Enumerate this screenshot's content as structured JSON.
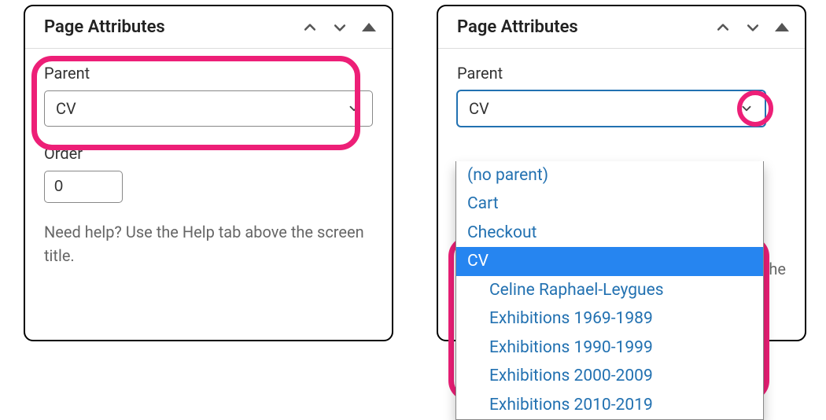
{
  "panel": {
    "title": "Page Attributes"
  },
  "parent": {
    "label": "Parent",
    "value": "CV"
  },
  "order": {
    "label": "Order",
    "value": "0"
  },
  "help": {
    "text": "Need help? Use the Help tab above the screen title."
  },
  "help_peek": "e the",
  "dropdown": {
    "no_parent": "(no parent)",
    "items": [
      {
        "label": "Cart",
        "indent": false,
        "active": false
      },
      {
        "label": "Checkout",
        "indent": false,
        "active": false
      },
      {
        "label": "CV",
        "indent": false,
        "active": true
      },
      {
        "label": "Celine Raphael-Leygues",
        "indent": true,
        "active": false
      },
      {
        "label": "Exhibitions 1969-1989",
        "indent": true,
        "active": false
      },
      {
        "label": "Exhibitions 1990-1999",
        "indent": true,
        "active": false
      },
      {
        "label": "Exhibitions 2000-2009",
        "indent": true,
        "active": false
      },
      {
        "label": "Exhibitions 2010-2019",
        "indent": true,
        "active": false
      }
    ]
  }
}
